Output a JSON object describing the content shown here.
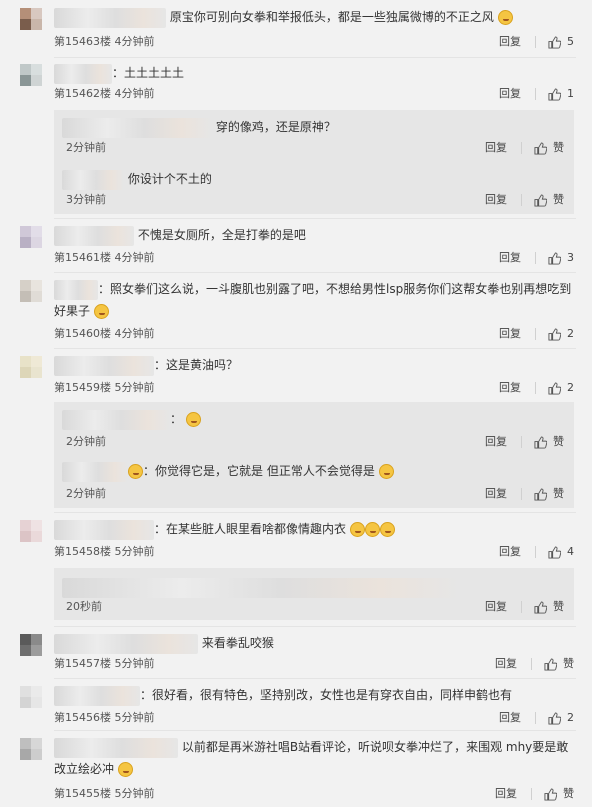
{
  "ui": {
    "reply_label": "回复",
    "like_label": "赞"
  },
  "comments": [
    {
      "text": "原宝你可别向女拳和举报低头，都是一些独属微博的不正之风",
      "floor": "第15463楼",
      "time": "4分钟前",
      "likes": "5"
    },
    {
      "text": "：土土土土土",
      "floor": "第15462楼",
      "time": "4分钟前",
      "likes": "1",
      "replies": [
        {
          "text": "穿的像鸡，还是原神？",
          "time": "2分钟前"
        },
        {
          "text": "你设计个不土的",
          "time": "3分钟前"
        }
      ]
    },
    {
      "text": "不愧是女厕所，全是打拳的是吧",
      "floor": "第15461楼",
      "time": "4分钟前",
      "likes": "3"
    },
    {
      "text": "：照女拳们这么说，一斗腹肌也别露了吧，不想给男性lsp服务你们这帮女拳也别再想吃到好果子",
      "floor": "第15460楼",
      "time": "4分钟前",
      "likes": "2"
    },
    {
      "text": "：这是黄油吗？",
      "floor": "第15459楼",
      "time": "5分钟前",
      "likes": "2",
      "replies": [
        {
          "text": "：",
          "time": "2分钟前"
        },
        {
          "text": "：你觉得它是，它就是 但正常人不会觉得是",
          "time": "2分钟前"
        }
      ]
    },
    {
      "text": "：在某些脏人眼里看啥都像情趣内衣",
      "floor": "第15458楼",
      "time": "5分钟前",
      "likes": "4",
      "replies": [
        {
          "text": "",
          "time": "20秒前"
        }
      ]
    },
    {
      "text": "来看拳乱咬猴",
      "floor": "第15457楼",
      "time": "5分钟前",
      "likes": ""
    },
    {
      "text": "：很好看，很有特色，坚持别改，女性也是有穿衣自由，同样申鹤也有",
      "floor": "第15456楼",
      "time": "5分钟前",
      "likes": "2"
    },
    {
      "text": "以前都是再米游社唱B站看评论，听说呗女拳冲烂了，来围观 mhy要是敢改立绘必冲",
      "floor": "第15455楼",
      "time": "5分钟前",
      "likes": ""
    }
  ]
}
